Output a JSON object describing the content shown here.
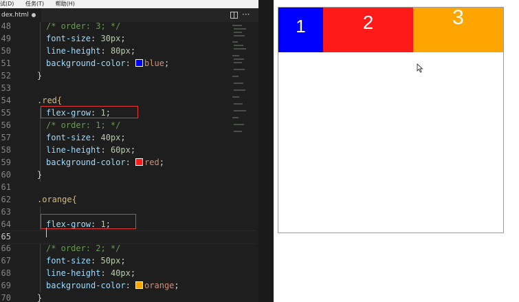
{
  "menubar": {
    "debug": "试(D)",
    "tasks": "任务(T)",
    "help": "帮助(H)"
  },
  "tab": {
    "filename": "dex.html"
  },
  "icons": {
    "split": "split-editor-icon",
    "more": "more-actions-icon",
    "unsaved": "unsaved-dot-icon"
  },
  "colors": {
    "blue": "#0000ff",
    "red": "#ff1a1a",
    "orange": "#ffa500",
    "highlight": "#e2383a"
  },
  "code": {
    "line_numbers": [
      "48",
      "49",
      "50",
      "51",
      "52",
      "53",
      "54",
      "55",
      "56",
      "57",
      "58",
      "59",
      "60",
      "61",
      "62",
      "63",
      "64",
      "65",
      "66",
      "67",
      "68",
      "69",
      "70"
    ],
    "l48": "/* order: 3; */",
    "l49_prop": "font-size",
    "l49_val": "30px",
    "l50_prop": "line-height",
    "l50_val": "80px",
    "l51_prop": "background-color",
    "l51_val": "blue",
    "l52": "}",
    "l54": ".red{",
    "l55_prop": "flex-grow",
    "l55_val": "1",
    "l56": "/* order: 1; */",
    "l57_prop": "font-size",
    "l57_val": "40px",
    "l58_prop": "line-height",
    "l58_val": "60px",
    "l59_prop": "background-color",
    "l59_val": "red",
    "l60": "}",
    "l62": ".orange{",
    "l64_prop": "flex-grow",
    "l64_val": "1",
    "l66": "/* order: 2; */",
    "l67_prop": "font-size",
    "l67_val": "50px",
    "l68_prop": "line-height",
    "l68_val": "40px",
    "l69_prop": "background-color",
    "l69_val": "orange",
    "l70": "}"
  },
  "preview": {
    "box1_label": "1",
    "box2_label": "2",
    "box3_label": "3"
  }
}
